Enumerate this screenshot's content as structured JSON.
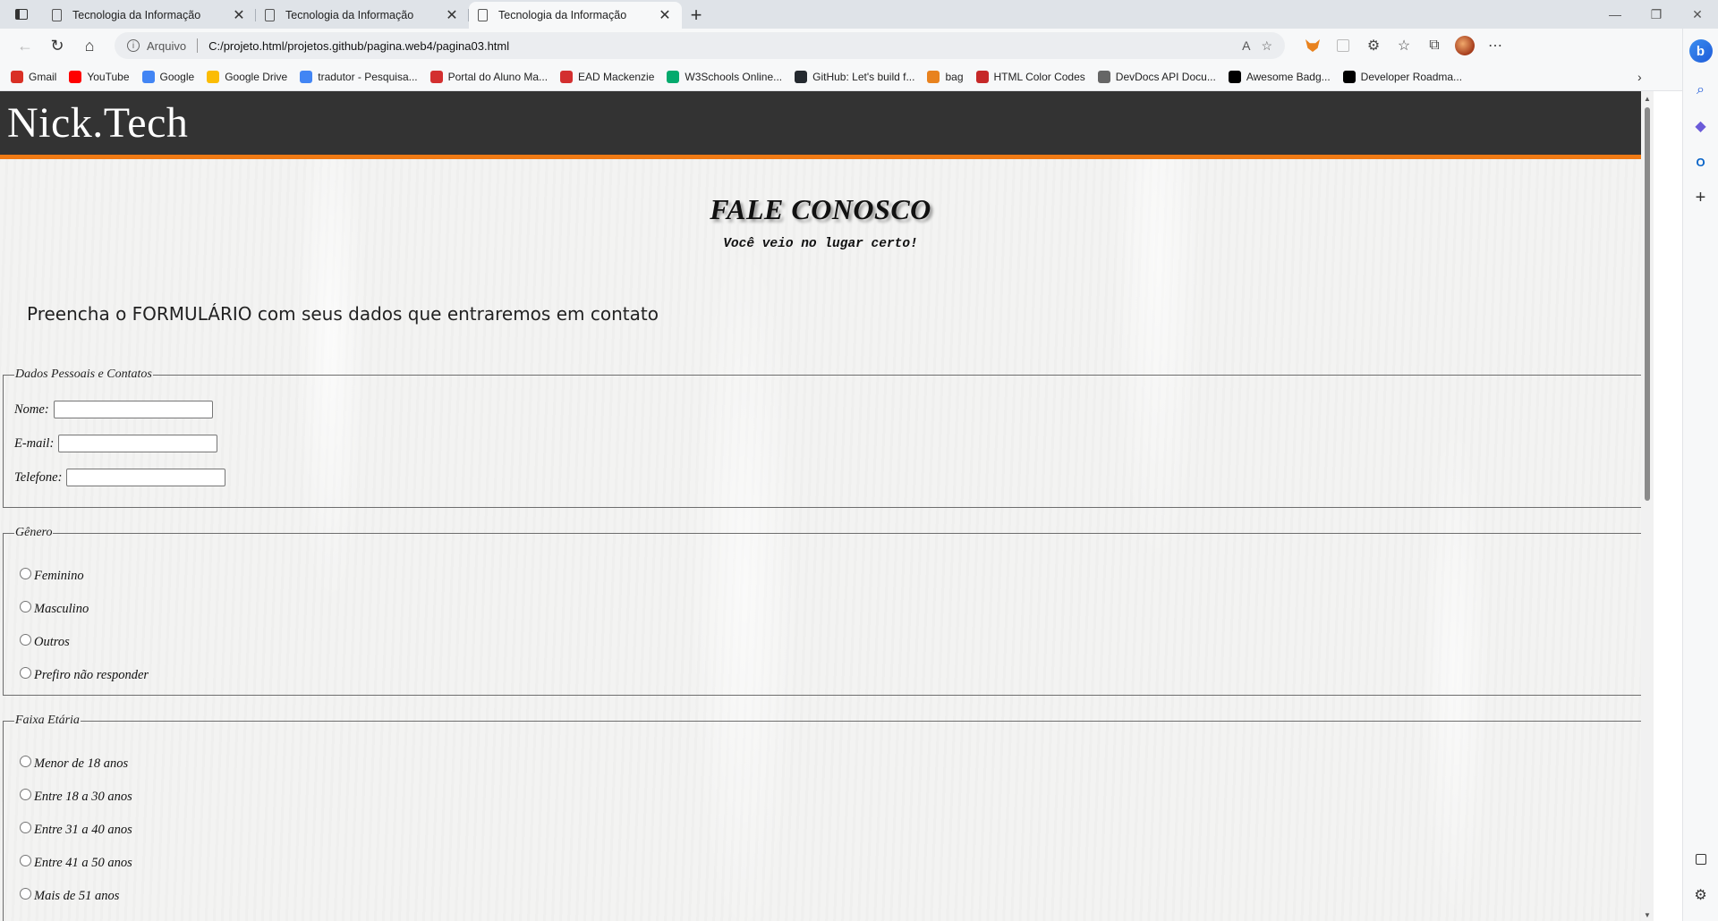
{
  "browser": {
    "tabs": [
      {
        "label": "Tecnologia da Informação",
        "active": false
      },
      {
        "label": "Tecnologia da Informação",
        "active": false
      },
      {
        "label": "Tecnologia da Informação",
        "active": true
      }
    ],
    "address": {
      "scheme": "Arquivo",
      "url": "C:/projeto.html/projetos.github/pagina.web4/pagina03.html"
    },
    "bookmarks": [
      {
        "label": "Gmail",
        "icon": "gmail-icon",
        "color": "#d93025"
      },
      {
        "label": "YouTube",
        "icon": "youtube-icon",
        "color": "#ff0000"
      },
      {
        "label": "Google",
        "icon": "google-icon",
        "color": "#4285f4"
      },
      {
        "label": "Google Drive",
        "icon": "drive-icon",
        "color": "#fbbc04"
      },
      {
        "label": "tradutor - Pesquisa...",
        "icon": "google-icon",
        "color": "#4285f4"
      },
      {
        "label": "Portal do Aluno Ma...",
        "icon": "mackenzie-icon",
        "color": "#d32f2f"
      },
      {
        "label": "EAD Mackenzie",
        "icon": "mackenzie-icon",
        "color": "#d32f2f"
      },
      {
        "label": "W3Schools Online...",
        "icon": "w3schools-icon",
        "color": "#04aa6d"
      },
      {
        "label": "GitHub: Let's build f...",
        "icon": "github-icon",
        "color": "#24292f"
      },
      {
        "label": "bag",
        "icon": "bag-icon",
        "color": "#e8821e"
      },
      {
        "label": "HTML Color Codes",
        "icon": "color-codes-icon",
        "color": "#c62828"
      },
      {
        "label": "DevDocs API Docu...",
        "icon": "devdocs-icon",
        "color": "#666666"
      },
      {
        "label": "Awesome Badg...",
        "icon": "dev-icon",
        "color": "#000000"
      },
      {
        "label": "Developer Roadma...",
        "icon": "roadmap-icon",
        "color": "#000000"
      }
    ]
  },
  "site": {
    "brand": "Nick.Tech",
    "title": "FALE CONOSCO",
    "subtitle": "Você veio no lugar certo!",
    "intro": "Preencha o FORMULÁRIO com seus dados que entraremos em contato"
  },
  "form": {
    "personal": {
      "legend": "Dados Pessoais e Contatos",
      "name_label": "Nome:",
      "email_label": "E-mail:",
      "phone_label": "Telefone:",
      "name_value": "",
      "email_value": "",
      "phone_value": ""
    },
    "gender": {
      "legend": "Gênero",
      "options": [
        "Feminino",
        "Masculino",
        "Outros",
        "Prefiro não responder"
      ]
    },
    "age": {
      "legend": "Faixa Etária",
      "options": [
        "Menor de 18 anos",
        "Entre 18 a 30 anos",
        "Entre 31 a 40 anos",
        "Entre 41 a 50 anos",
        "Mais de 51 anos"
      ]
    }
  },
  "colors": {
    "header_bg": "#333333",
    "header_accent": "#f07a14"
  }
}
